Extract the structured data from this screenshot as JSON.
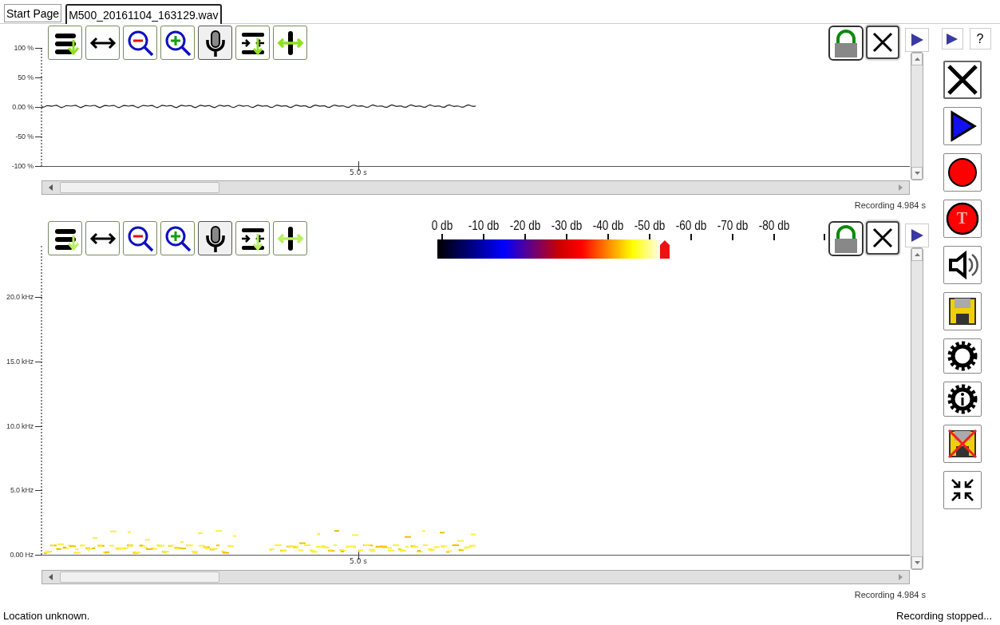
{
  "tabs": [
    {
      "label": "Start Page",
      "selected": false
    },
    {
      "label": "M500_20161104_163129.wav",
      "selected": true
    }
  ],
  "panels": [
    {
      "kind": "waveform",
      "y_axis": [
        "100 %",
        "50 %",
        "0.00 %",
        "-50 %",
        "-100 %"
      ],
      "x_axis": [
        "5.0 s"
      ],
      "caption": "Recording 4.984 s"
    },
    {
      "kind": "spectrogram",
      "y_axis": [
        "20.0 kHz",
        "15.0 kHz",
        "10.0 kHz",
        "5.0 kHz",
        "0.00 Hz"
      ],
      "x_axis": [
        "5.0 s"
      ],
      "color_scale": {
        "labels": [
          "0 db",
          "-10 db",
          "-20 db",
          "-30 db",
          "-40 db",
          "-50 db",
          "-60 db",
          "-70 db",
          "-80 db"
        ],
        "level": 0.58
      },
      "caption": "Recording 4.984 s"
    }
  ],
  "sidebar": {
    "help_button": "?",
    "timed_record_label": "T"
  },
  "status_bar": {
    "left": "Location unknown.",
    "right": "Recording stopped..."
  }
}
